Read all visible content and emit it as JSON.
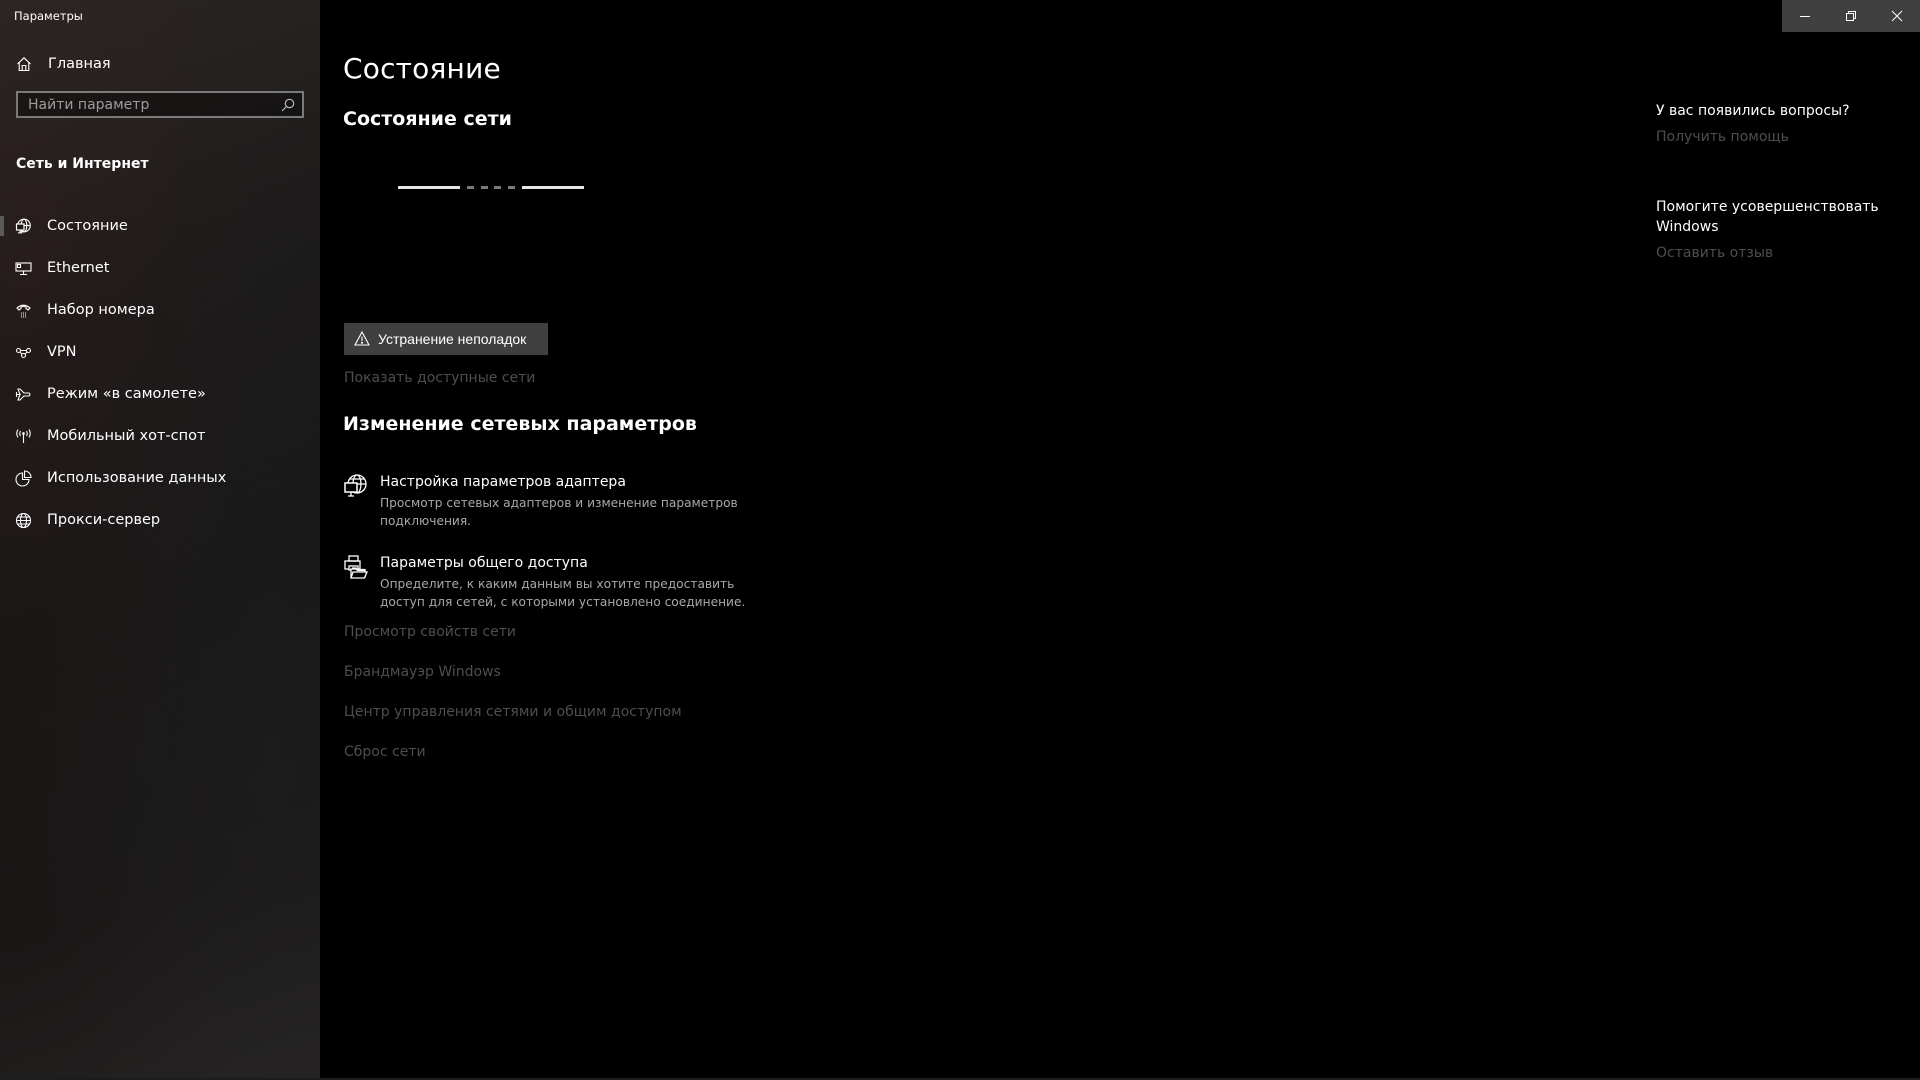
{
  "window": {
    "title": "Параметры",
    "controls": {
      "minimize_icon": "minimize-icon",
      "restore_icon": "restore-icon",
      "close_icon": "close-icon"
    }
  },
  "sidebar": {
    "home": {
      "label": "Главная",
      "icon": "home-icon"
    },
    "search": {
      "placeholder": "Найти параметр",
      "value": "",
      "icon": "search-icon"
    },
    "section_title": "Сеть и Интернет",
    "items": [
      {
        "label": "Состояние",
        "icon": "network-status-icon",
        "selected": true
      },
      {
        "label": "Ethernet",
        "icon": "ethernet-icon",
        "selected": false
      },
      {
        "label": "Набор номера",
        "icon": "dial-up-icon",
        "selected": false
      },
      {
        "label": "VPN",
        "icon": "vpn-icon",
        "selected": false
      },
      {
        "label": "Режим «в самолете»",
        "icon": "airplane-icon",
        "selected": false
      },
      {
        "label": "Мобильный хот-спот",
        "icon": "hotspot-icon",
        "selected": false
      },
      {
        "label": "Использование данных",
        "icon": "data-usage-icon",
        "selected": false
      },
      {
        "label": "Прокси-сервер",
        "icon": "globe-icon",
        "selected": false
      }
    ]
  },
  "main": {
    "page_title": "Состояние",
    "network_status_title": "Состояние сети",
    "network_diagram": {
      "state": "disconnected"
    },
    "troubleshoot_button": {
      "label": "Устранение неполадок",
      "icon": "warning-icon"
    },
    "show_networks_link": "Показать доступные сети",
    "change_section_title": "Изменение сетевых параметров",
    "settings": [
      {
        "title": "Настройка параметров адаптера",
        "description": "Просмотр сетевых адаптеров и изменение параметров подключения.",
        "icon": "adapter-icon"
      },
      {
        "title": "Параметры общего доступа",
        "description": "Определите, к каким данным вы хотите предоставить доступ для сетей, с которыми установлено соединение.",
        "icon": "sharing-icon"
      }
    ],
    "links": [
      "Просмотр свойств сети",
      "Брандмауэр Windows",
      "Центр управления сетями и общим доступом",
      "Сброс сети"
    ]
  },
  "right_panel": {
    "questions_title": "У вас появились вопросы?",
    "get_help_link": "Получить помощь",
    "feedback_title": "Помогите усовершенствовать Windows",
    "feedback_link": "Оставить отзыв"
  },
  "colors": {
    "background": "#000000",
    "button_bg": "#404040",
    "disabled_link": "#4e4e4e",
    "description_text": "#a8a8a8",
    "selection_indicator": "#5a5a5a"
  }
}
